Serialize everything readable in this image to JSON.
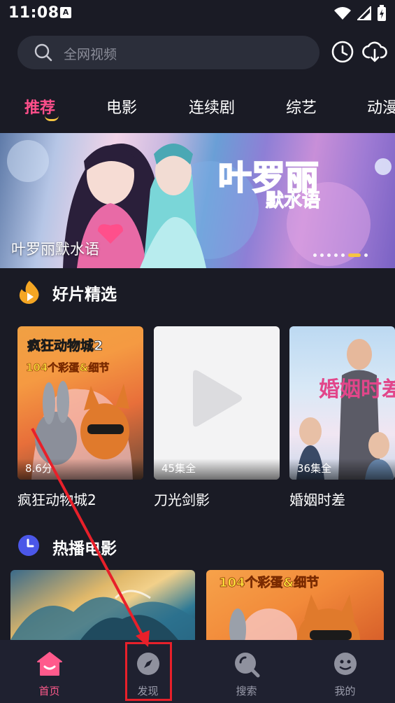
{
  "status": {
    "time": "11:08",
    "notif_letter": "A"
  },
  "search": {
    "placeholder": "全网视频"
  },
  "tabs": [
    {
      "label": "推荐",
      "active": true
    },
    {
      "label": "电影"
    },
    {
      "label": "连续剧"
    },
    {
      "label": "综艺"
    },
    {
      "label": "动漫"
    }
  ],
  "banner": {
    "title": "叶罗丽默水语",
    "logo_text": "叶罗丽",
    "logo_sub": "默水语",
    "dots": 7,
    "active_dot": 5
  },
  "featured": {
    "title": "好片精选",
    "items": [
      {
        "name": "疯狂动物城2",
        "badge": "8.6分",
        "poster_title": "疯狂动物城2",
        "poster_sub": "104个彩蛋&细节"
      },
      {
        "name": "刀光剑影",
        "badge": "45集全"
      },
      {
        "name": "婚姻时差",
        "badge": "36集全",
        "poster_title": "婚姻时差"
      }
    ]
  },
  "hot": {
    "title": "热播电影",
    "second_poster_text": "104个彩蛋&细节"
  },
  "nav": [
    {
      "label": "首页",
      "active": true
    },
    {
      "label": "发现"
    },
    {
      "label": "搜索"
    },
    {
      "label": "我的"
    }
  ],
  "colors": {
    "accent": "#ff4f8b",
    "underline": "#f5c542",
    "annotation": "#e8202a",
    "background": "#1a1b25"
  }
}
